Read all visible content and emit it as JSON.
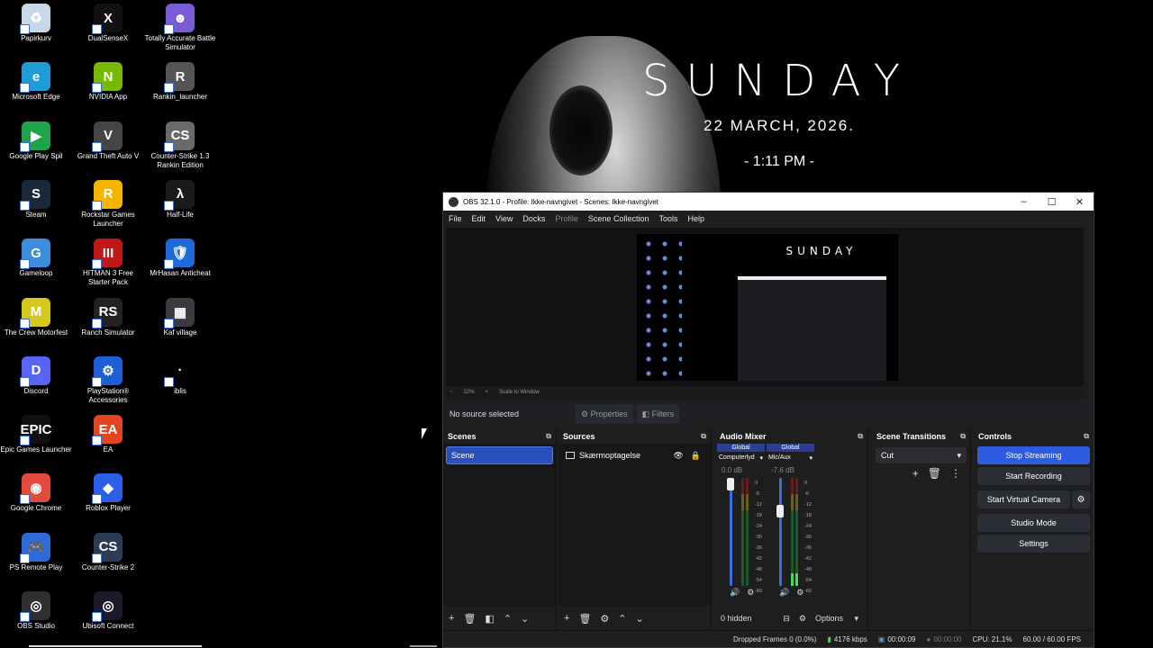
{
  "desktop": {
    "icons": [
      {
        "label": "Papirkurv",
        "icon": "recycle-bin-icon",
        "color": "#c8d8e8",
        "glyph": "♻",
        "col": 0,
        "row": 0
      },
      {
        "label": "Microsoft Edge",
        "icon": "edge-icon",
        "color": "#1f9cd6",
        "glyph": "e",
        "col": 0,
        "row": 1
      },
      {
        "label": "Google Play Spil",
        "icon": "google-play-games-icon",
        "color": "#1fa34a",
        "glyph": "▶",
        "col": 0,
        "row": 2
      },
      {
        "label": "Steam",
        "icon": "steam-icon",
        "color": "#1b2838",
        "glyph": "S",
        "col": 0,
        "row": 3
      },
      {
        "label": "Gameloop",
        "icon": "gameloop-icon",
        "color": "#3b8de0",
        "glyph": "G",
        "col": 0,
        "row": 4
      },
      {
        "label": "The Crew Motorfest",
        "icon": "crew-motorfest-icon",
        "color": "#d6c81f",
        "glyph": "M",
        "col": 0,
        "row": 5
      },
      {
        "label": "Discord",
        "icon": "discord-icon",
        "color": "#5865f2",
        "glyph": "D",
        "col": 0,
        "row": 6
      },
      {
        "label": "Epic Games Launcher",
        "icon": "epic-games-icon",
        "color": "#111111",
        "glyph": "EPIC",
        "col": 0,
        "row": 7
      },
      {
        "label": "Google Chrome",
        "icon": "chrome-icon",
        "color": "#e24a3b",
        "glyph": "◉",
        "col": 0,
        "row": 8
      },
      {
        "label": "PS Remote Play",
        "icon": "ps-remote-play-icon",
        "color": "#2f6ad9",
        "glyph": "🎮",
        "col": 0,
        "row": 9
      },
      {
        "label": "OBS Studio",
        "icon": "obs-icon",
        "color": "#302e31",
        "glyph": "◎",
        "col": 0,
        "row": 10
      },
      {
        "label": "DualSenseX",
        "icon": "dualsensex-icon",
        "color": "#111111",
        "glyph": "X",
        "col": 1,
        "row": 0
      },
      {
        "label": "NVIDIA App",
        "icon": "nvidia-icon",
        "color": "#76b900",
        "glyph": "N",
        "col": 1,
        "row": 1
      },
      {
        "label": "Grand Theft Auto V",
        "icon": "gta5-icon",
        "color": "#444444",
        "glyph": "V",
        "col": 1,
        "row": 2
      },
      {
        "label": "Rockstar Games Launcher",
        "icon": "rockstar-icon",
        "color": "#f4b400",
        "glyph": "R",
        "col": 1,
        "row": 3
      },
      {
        "label": "HITMAN 3 Free Starter Pack",
        "icon": "hitman-icon",
        "color": "#c01818",
        "glyph": "III",
        "col": 1,
        "row": 4
      },
      {
        "label": "Ranch Simulator",
        "icon": "ranch-simulator-icon",
        "color": "#222222",
        "glyph": "RS",
        "col": 1,
        "row": 5
      },
      {
        "label": "PlayStation® Accessories",
        "icon": "playstation-accessories-icon",
        "color": "#1f5fd6",
        "glyph": "⚙",
        "col": 1,
        "row": 6
      },
      {
        "label": "EA",
        "icon": "ea-icon",
        "color": "#e2451f",
        "glyph": "EA",
        "col": 1,
        "row": 7
      },
      {
        "label": "Roblox Player",
        "icon": "roblox-icon",
        "color": "#2b5fe8",
        "glyph": "◆",
        "col": 1,
        "row": 8
      },
      {
        "label": "Counter-Strike 2",
        "icon": "cs2-icon",
        "color": "#2d3c55",
        "glyph": "CS",
        "col": 1,
        "row": 9
      },
      {
        "label": "Ubisoft Connect",
        "icon": "ubisoft-icon",
        "color": "#1a1a2a",
        "glyph": "◎",
        "col": 1,
        "row": 10
      },
      {
        "label": "Totally Accurate Battle Simulator",
        "icon": "tabs-icon",
        "color": "#7a5cd6",
        "glyph": "☻",
        "col": 2,
        "row": 0
      },
      {
        "label": "Rankin_launcher",
        "icon": "rankin-launcher-icon",
        "color": "#555555",
        "glyph": "R",
        "col": 2,
        "row": 1
      },
      {
        "label": "Counter-Strike 1.3 Rankin Edition",
        "icon": "cs13-icon",
        "color": "#6a6a6a",
        "glyph": "CS",
        "col": 2,
        "row": 2
      },
      {
        "label": "Half-Life",
        "icon": "half-life-icon",
        "color": "#1a1a1a",
        "glyph": "λ",
        "col": 2,
        "row": 3
      },
      {
        "label": "MrHasan Anticheat",
        "icon": "anticheat-icon",
        "color": "#1f6ad9",
        "glyph": "🛡",
        "col": 2,
        "row": 4
      },
      {
        "label": "Kaf village",
        "icon": "kaf-village-icon",
        "color": "#3a3a40",
        "glyph": "▦",
        "col": 2,
        "row": 5
      },
      {
        "label": "iblis",
        "icon": "iblis-icon",
        "color": "#000000",
        "glyph": "·",
        "col": 2,
        "row": 6
      }
    ]
  },
  "wallpaper": {
    "day": "SUNDAY",
    "date": "22 MARCH, 2026.",
    "time": "- 1:11 PM -"
  },
  "obs": {
    "title": "OBS 32.1.0 - Profile: Ikke-navngivet - Scenes: Ikke-navngivet",
    "menu": [
      "File",
      "Edit",
      "View",
      "Docks",
      "Profile",
      "Scene Collection",
      "Tools",
      "Help"
    ],
    "zoom": "22%",
    "zoom_mode": "Scale to Window",
    "no_source": "No source selected",
    "properties": "Properties",
    "filters": "Filters",
    "scenes": {
      "header": "Scenes",
      "items": [
        "Scene"
      ]
    },
    "sources": {
      "header": "Sources",
      "items": [
        "Skærmoptagelse"
      ]
    },
    "mixer": {
      "header": "Audio Mixer",
      "channels": [
        {
          "global": "Global",
          "name": "Computerlyd",
          "db": "0.0 dB",
          "volume": 1.0,
          "level": 0.0
        },
        {
          "global": "Global",
          "name": "Mic/Aux",
          "db": "-7.6 dB",
          "volume": 0.72,
          "level": 0.12
        }
      ],
      "scale": [
        "0",
        "-6",
        "-12",
        "-18",
        "-24",
        "-30",
        "-36",
        "-42",
        "-48",
        "-54",
        "-60"
      ],
      "hidden": "0 hidden",
      "options": "Options"
    },
    "transitions": {
      "header": "Scene Transitions",
      "selected": "Cut"
    },
    "controls": {
      "header": "Controls",
      "stop_streaming": "Stop Streaming",
      "start_recording": "Start Recording",
      "start_virtual_camera": "Start Virtual Camera",
      "studio_mode": "Studio Mode",
      "settings": "Settings"
    },
    "status": {
      "dropped": "Dropped Frames 0 (0.0%)",
      "kbps": "4176 kbps",
      "stream_time": "00:00:09",
      "rec_time": "00:00:00",
      "cpu": "CPU: 21.1%",
      "fps": "60.00 / 60.00 FPS"
    }
  }
}
